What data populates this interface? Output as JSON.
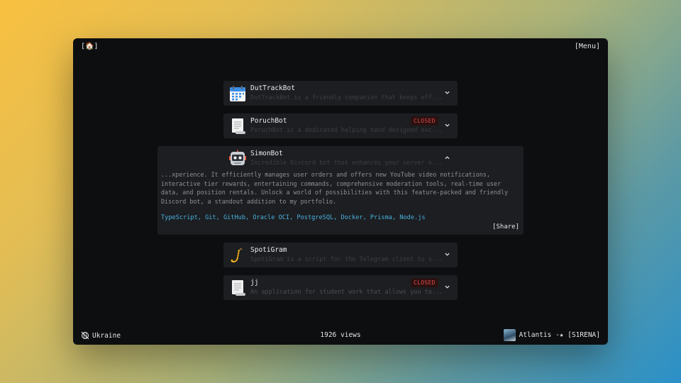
{
  "topbar": {
    "home_open": "[",
    "home_icon": "🏠",
    "home_close": "]",
    "menu_label": "[Menu]"
  },
  "projects": [
    {
      "title": "DutTrackBot",
      "description": "DutTrackBot is a friendly companion that keeps eff...",
      "status": "",
      "icon": "calendar-icon",
      "expanded": false
    },
    {
      "title": "PoruchBot",
      "description": "PoruchBot is a dedicated helping hand designed exc...",
      "status": "CLOSED",
      "icon": "scroll-icon",
      "expanded": false
    },
    {
      "title": "SimonBot",
      "description": "Incredible Discord bot that enhances your server e...",
      "status": "",
      "icon": "robot-icon",
      "expanded": true,
      "details": "...xperience. It efficiently manages user orders and offers new YouTube video notifications, interactive tier rewards, entertaining commands, comprehensive moderation tools, real-time user data, and position rentals. Unlock a world of possibilities with this feature-packed and friendly Discord bot, a standout addition to my portfolio.",
      "technologies": "TypeScript, Git, GitHub, Oracle OCI, PostgreSQL, Docker, Prisma, Node.js",
      "share_label": "[Share]"
    },
    {
      "title": "SpotiGram",
      "description": "SpotiGram is a script for the Telegram client to s...",
      "status": "",
      "icon": "saxophone-icon",
      "expanded": false
    },
    {
      "title": "jj",
      "description": "An application for student work that allows you to...",
      "status": "CLOSED",
      "icon": "scroll-icon",
      "expanded": false
    }
  ],
  "footer": {
    "location": "Ukraine",
    "views": "1926 views",
    "now_playing": "Atlantis -★ [S1RENA]"
  },
  "colors": {
    "closed_badge": "#e24a48",
    "tech_link": "#4ab0e0",
    "card_bg": "#1c1e21",
    "window_bg": "#0d0e10"
  }
}
